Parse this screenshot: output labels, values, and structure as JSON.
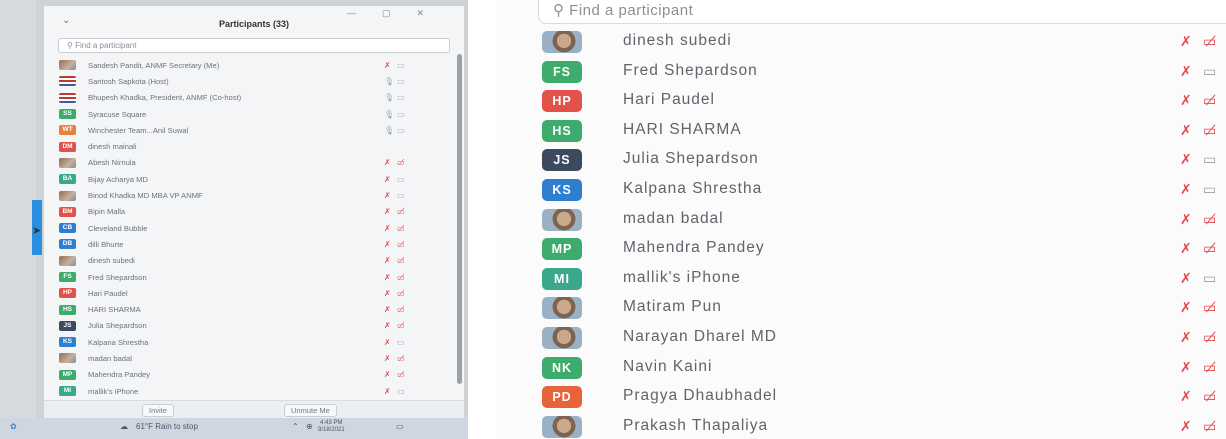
{
  "left": {
    "title": "Participants (33)",
    "search_placeholder": "Find a participant",
    "participants": [
      {
        "name": "Sandesh Pandit, ANMF Secretary (Me)",
        "initials": "",
        "avatar": "photo",
        "color": "",
        "mic": "muted",
        "cam": "on"
      },
      {
        "name": "Santosh Sapkota (Host)",
        "initials": "",
        "avatar": "flag",
        "color": "",
        "mic": "on",
        "cam": "on"
      },
      {
        "name": "Bhupesh Khadka, President, ANMF (Co-host)",
        "initials": "",
        "avatar": "flag",
        "color": "",
        "mic": "on",
        "cam": "on"
      },
      {
        "name": "Syracuse Square",
        "initials": "SS",
        "avatar": "initials",
        "color": "#3dab6b",
        "mic": "on",
        "cam": "on"
      },
      {
        "name": "Winchester Team...Anil Suwal",
        "initials": "WT",
        "avatar": "initials",
        "color": "#e8823a",
        "mic": "on",
        "cam": "on"
      },
      {
        "name": "dinesh mainali",
        "initials": "DM",
        "avatar": "initials",
        "color": "#e0524a",
        "mic": "none",
        "cam": "none"
      },
      {
        "name": "Abesh Nirnula",
        "initials": "",
        "avatar": "photo",
        "color": "",
        "mic": "muted",
        "cam": "off"
      },
      {
        "name": "Bijay Acharya MD",
        "initials": "BA",
        "avatar": "initials",
        "color": "#3aa88a",
        "mic": "muted",
        "cam": "on"
      },
      {
        "name": "Binod Khadka MD MBA VP  ANMF",
        "initials": "",
        "avatar": "photo",
        "color": "",
        "mic": "muted",
        "cam": "on"
      },
      {
        "name": "Bipin Malla",
        "initials": "BM",
        "avatar": "initials",
        "color": "#e0524a",
        "mic": "muted",
        "cam": "off"
      },
      {
        "name": "Cleveland Bubble",
        "initials": "CB",
        "avatar": "initials",
        "color": "#2f7fd0",
        "mic": "muted",
        "cam": "off"
      },
      {
        "name": "dilli Bhurte",
        "initials": "DB",
        "avatar": "initials",
        "color": "#2f7fd0",
        "mic": "muted",
        "cam": "off"
      },
      {
        "name": "dinesh subedi",
        "initials": "",
        "avatar": "photo",
        "color": "",
        "mic": "muted",
        "cam": "off"
      },
      {
        "name": "Fred Shepardson",
        "initials": "FS",
        "avatar": "initials",
        "color": "#3dab6b",
        "mic": "muted",
        "cam": "off"
      },
      {
        "name": "Hari Paudel",
        "initials": "HP",
        "avatar": "initials",
        "color": "#e0524a",
        "mic": "muted",
        "cam": "off"
      },
      {
        "name": "HARI SHARMA",
        "initials": "HS",
        "avatar": "initials",
        "color": "#3dab6b",
        "mic": "muted",
        "cam": "off"
      },
      {
        "name": "Julia Shepardson",
        "initials": "JS",
        "avatar": "initials",
        "color": "#3b4a5e",
        "mic": "muted",
        "cam": "off"
      },
      {
        "name": "Kalpana Shrestha",
        "initials": "KS",
        "avatar": "initials",
        "color": "#2f7fd0",
        "mic": "muted",
        "cam": "on"
      },
      {
        "name": "madan badal",
        "initials": "",
        "avatar": "photo",
        "color": "",
        "mic": "muted",
        "cam": "off"
      },
      {
        "name": "Mahendra Pandey",
        "initials": "MP",
        "avatar": "initials",
        "color": "#3dab6b",
        "mic": "muted",
        "cam": "off"
      },
      {
        "name": "mallik's iPhone",
        "initials": "MI",
        "avatar": "initials",
        "color": "#3aa88a",
        "mic": "muted",
        "cam": "on"
      }
    ],
    "invite_label": "Invite",
    "unmute_label": "Unmute Me",
    "taskbar": {
      "weather": "61°F  Rain to stop",
      "time": "4:43 PM",
      "date": "9/18/2021"
    }
  },
  "right": {
    "search_placeholder": "Find a participant",
    "participants": [
      {
        "name": "dinesh subedi",
        "initials": "",
        "avatar": "photo",
        "color": "",
        "cam": "off"
      },
      {
        "name": "Fred Shepardson",
        "initials": "FS",
        "avatar": "initials",
        "color": "#3dab6b",
        "cam": "on"
      },
      {
        "name": "Hari Paudel",
        "initials": "HP",
        "avatar": "initials",
        "color": "#e0524a",
        "cam": "off"
      },
      {
        "name": "HARI SHARMA",
        "initials": "HS",
        "avatar": "initials",
        "color": "#3dab6b",
        "cam": "off"
      },
      {
        "name": "Julia Shepardson",
        "initials": "JS",
        "avatar": "initials",
        "color": "#3b4a5e",
        "cam": "on"
      },
      {
        "name": "Kalpana Shrestha",
        "initials": "KS",
        "avatar": "initials",
        "color": "#2f7fd0",
        "cam": "on"
      },
      {
        "name": "madan badal",
        "initials": "",
        "avatar": "photo",
        "color": "",
        "cam": "off"
      },
      {
        "name": "Mahendra Pandey",
        "initials": "MP",
        "avatar": "initials",
        "color": "#3dab6b",
        "cam": "off"
      },
      {
        "name": "mallik's iPhone",
        "initials": "MI",
        "avatar": "initials",
        "color": "#3aa88a",
        "cam": "on"
      },
      {
        "name": "Matiram Pun",
        "initials": "",
        "avatar": "photo",
        "color": "",
        "cam": "off"
      },
      {
        "name": "Narayan Dharel MD",
        "initials": "",
        "avatar": "photo",
        "color": "",
        "cam": "off"
      },
      {
        "name": "Navin Kaini",
        "initials": "NK",
        "avatar": "initials",
        "color": "#3dab6b",
        "cam": "off"
      },
      {
        "name": "Pragya Dhaubhadel",
        "initials": "PD",
        "avatar": "initials",
        "color": "#e8623a",
        "cam": "off"
      },
      {
        "name": "Prakash Thapaliya",
        "initials": "",
        "avatar": "photo",
        "color": "",
        "cam": "off"
      }
    ]
  },
  "icons": {
    "search": "search-icon",
    "mic_muted": "mic-muted-icon",
    "mic_on": "mic-icon",
    "cam_off": "video-off-icon",
    "cam_on": "video-icon"
  }
}
